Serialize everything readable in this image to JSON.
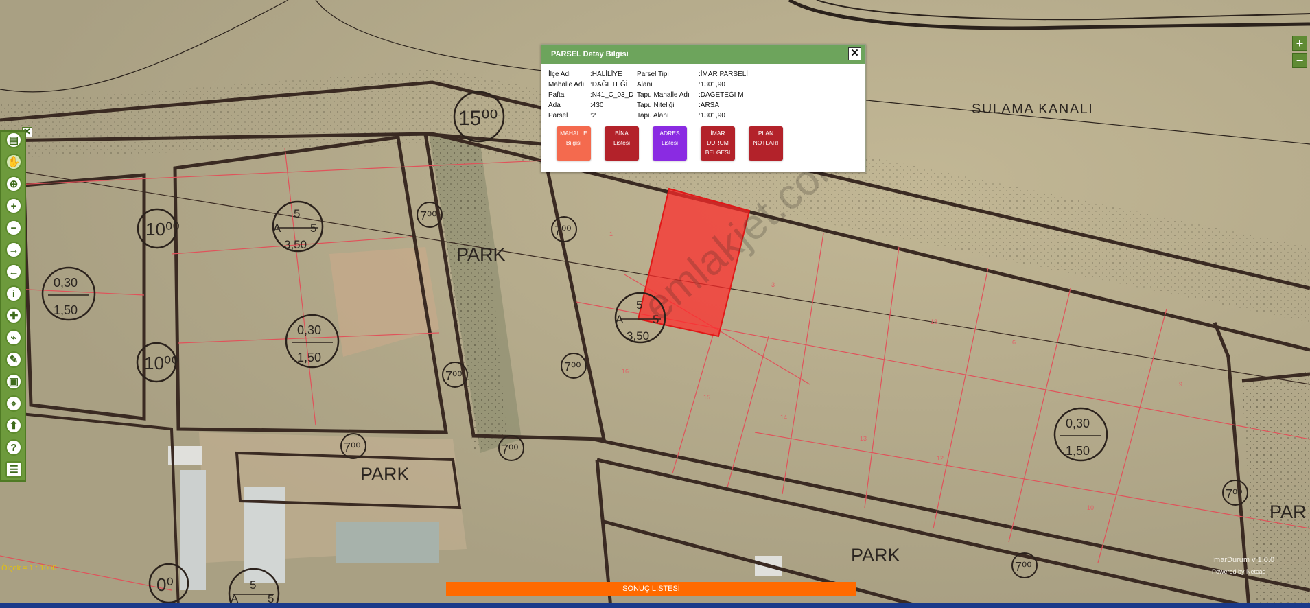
{
  "popup": {
    "title": "PARSEL Detay Bilgisi",
    "close": "✕",
    "fields_left": [
      {
        "key": "İlçe Adı",
        "value": ":HALİLİYE"
      },
      {
        "key": "Mahalle Adı",
        "value": ":DAĞETEĞİ"
      },
      {
        "key": "Pafta",
        "value": ":N41_C_03_D"
      },
      {
        "key": "Ada",
        "value": ":430"
      },
      {
        "key": "Parsel",
        "value": ":2"
      }
    ],
    "fields_right": [
      {
        "key": "Parsel Tipi",
        "value": ":İMAR PARSELİ"
      },
      {
        "key": "Alanı",
        "value": ":1301,90"
      },
      {
        "key": "Tapu Mahalle Adı",
        "value": ":DAĞETEĞİ M"
      },
      {
        "key": "Tapu Niteliği",
        "value": ":ARSA"
      },
      {
        "key": "Tapu Alanı",
        "value": ":1301,90"
      }
    ],
    "buttons": [
      {
        "line1": "MAHALLE",
        "line2": "Bilgisi",
        "line3": "",
        "color": "#f46a4e"
      },
      {
        "line1": "BİNA",
        "line2": "Listesi",
        "line3": "",
        "color": "#b3222a"
      },
      {
        "line1": "ADRES",
        "line2": "Listesi",
        "line3": "",
        "color": "#8a2be2"
      },
      {
        "line1": "İMAR",
        "line2": "DURUM",
        "line3": "BELGESİ",
        "color": "#b3222a"
      },
      {
        "line1": "PLAN",
        "line2": "NOTLARI",
        "line3": "",
        "color": "#b3222a"
      }
    ]
  },
  "map_labels": {
    "sulama": "SULAMA KANALI",
    "park_top": "PARK",
    "park_bottom_left": "PARK",
    "park_bottom_right": "PARK",
    "park_far_right": "PAR"
  },
  "map_markers": {
    "road_15": "15⁰⁰",
    "road_10a": "10⁰⁰",
    "road_10b": "10⁰⁰",
    "road_10c": "0⁰",
    "road_7": "7⁰⁰",
    "a5_top": "5",
    "a5_left": "A",
    "a5_right": "5",
    "a5_bottom": "3,50",
    "r030_top": "0,30",
    "r030_bottom": "1,50",
    "bottom_a5_top": "5",
    "bottom_a5_left": "A",
    "bottom_a5_right": "5"
  },
  "parcel_numbers": {
    "n1": "16",
    "n2": "15",
    "n3": "14",
    "n4": "13",
    "n5": "12",
    "n6": "10",
    "n7": "1",
    "n8": "3",
    "n9": "6",
    "n10": "18",
    "n11": "9"
  },
  "watermark": "emlakjet.com",
  "zoom": {
    "in": "+",
    "out": "−"
  },
  "toolbar": {
    "close": "✕",
    "icons": [
      "▤",
      "✋",
      "⊕",
      "+",
      "−",
      "→",
      "←",
      "i",
      "✚",
      "⌁",
      "✎",
      "▣",
      "⌖",
      "⬆",
      "?",
      "☰"
    ]
  },
  "scale_text": "Ölçek = 1 : 1000",
  "version_text": "İmarDurum v 1.0.0",
  "powered_text": "Powered by Netcad",
  "results_label": "SONUÇ LİSTESİ",
  "colors": {
    "popup_header": "#6da45c",
    "toolbar_bg": "#6d9a3c",
    "results_bar": "#ff6a00",
    "selected_parcel": "#ff2a2a",
    "road_line": "#3a2a22"
  }
}
